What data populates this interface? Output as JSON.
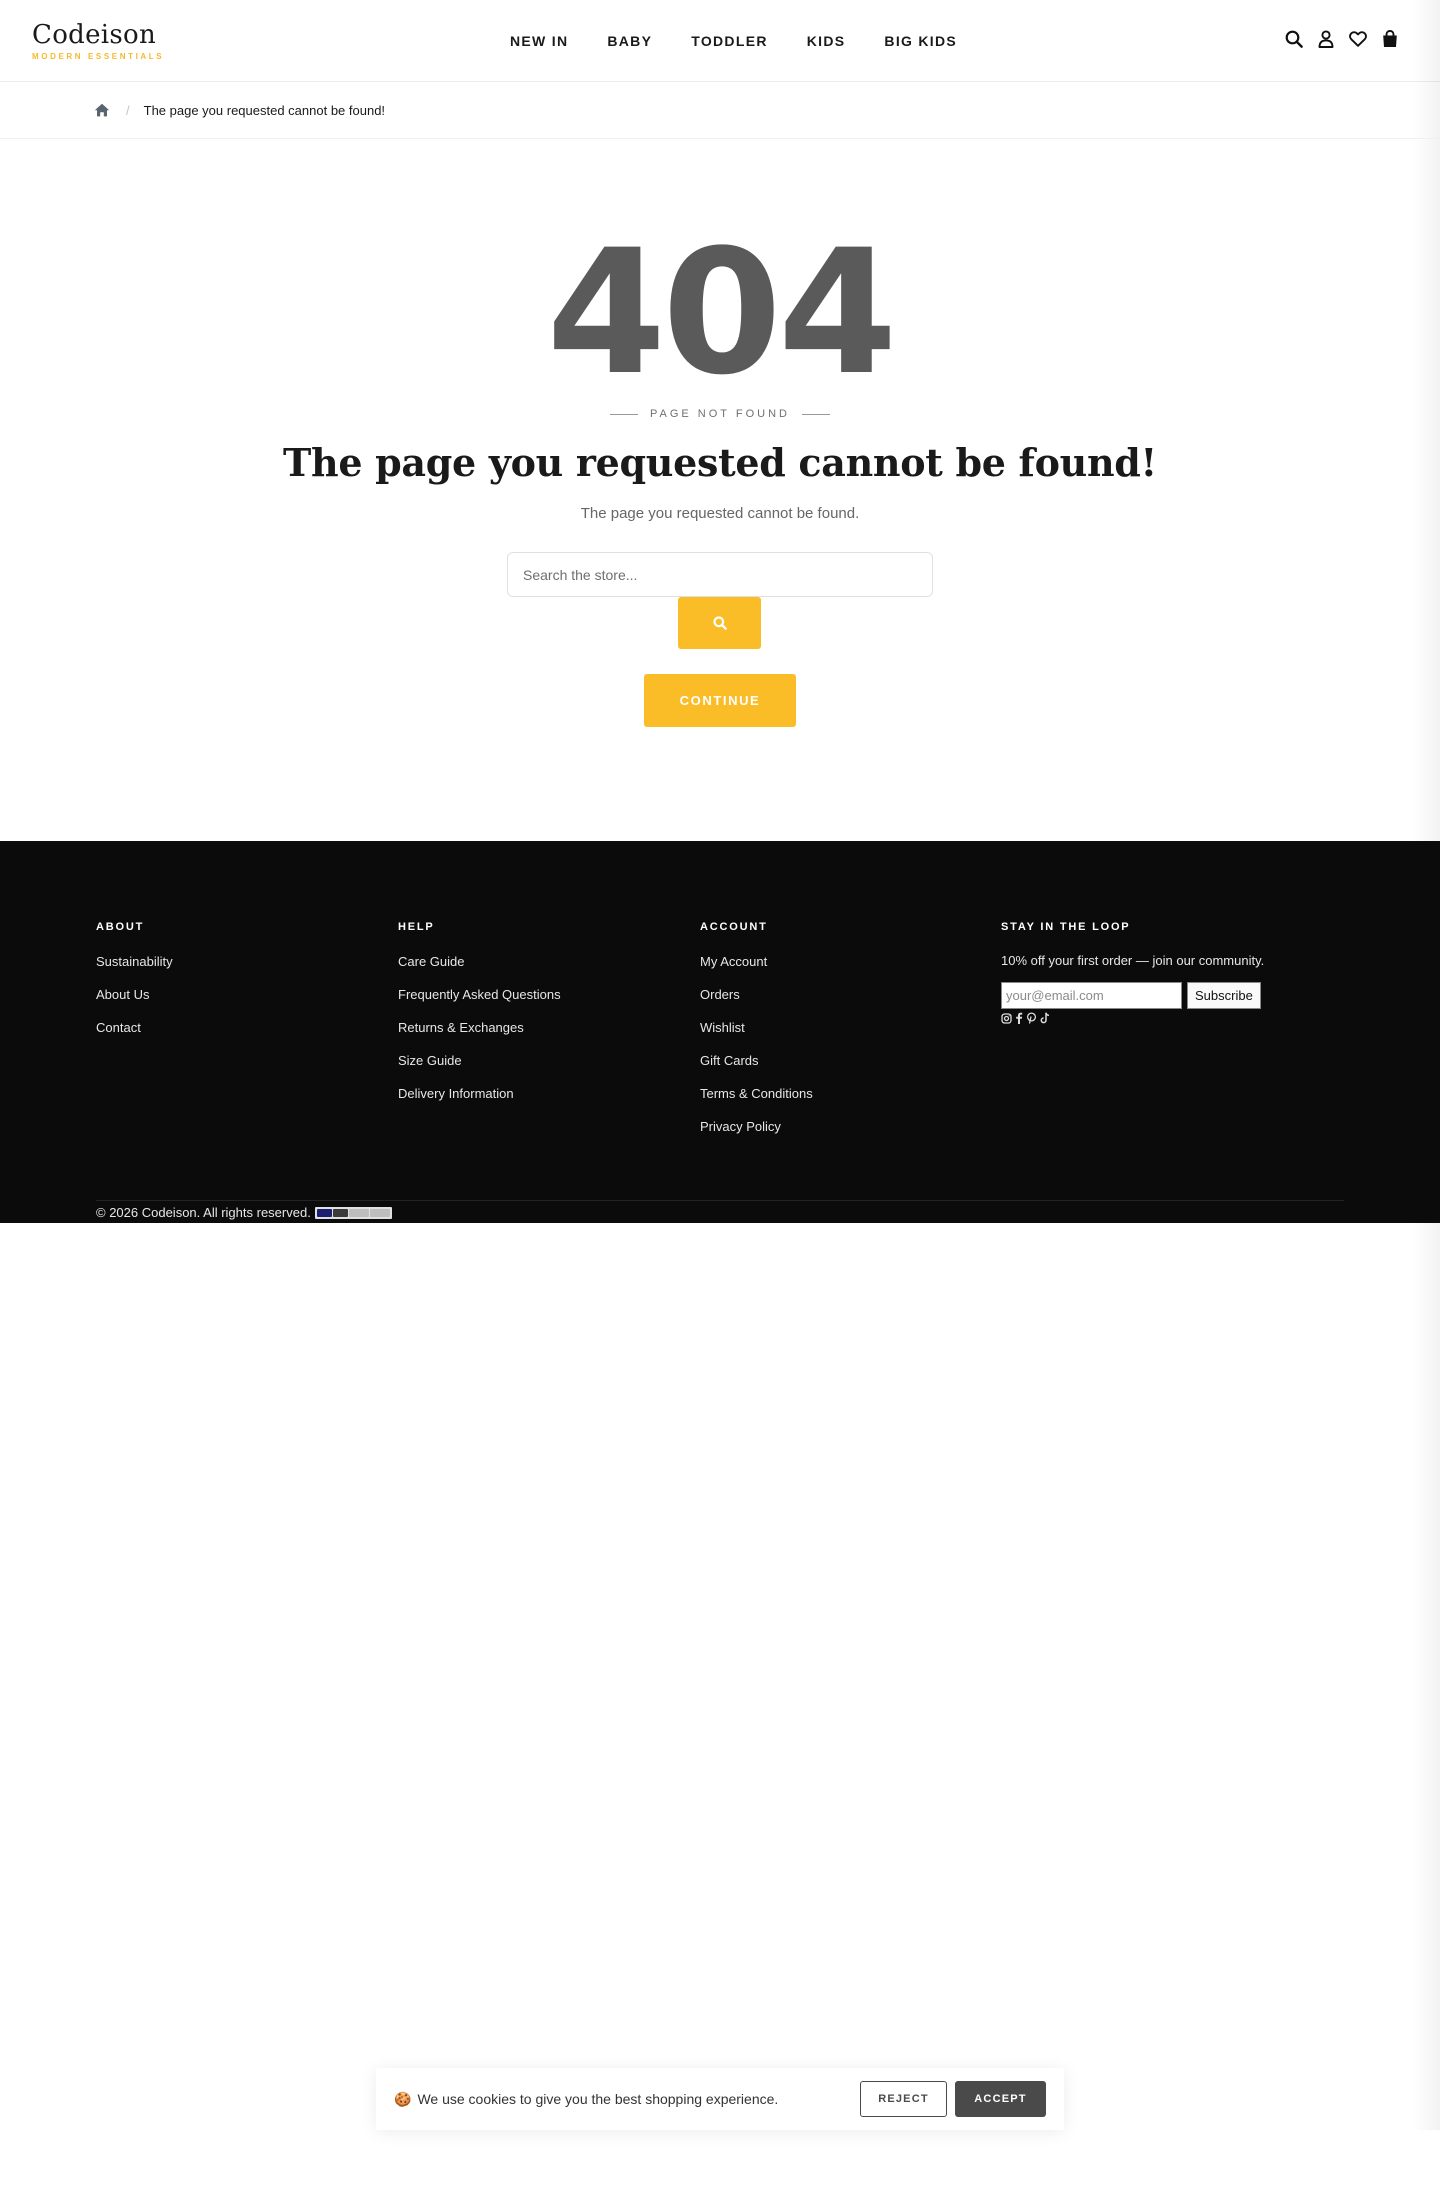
{
  "header": {
    "logo_name": "Codeison",
    "logo_tagline": "MODERN ESSENTIALS",
    "nav": [
      "NEW IN",
      "BABY",
      "TODDLER",
      "KIDS",
      "BIG KIDS"
    ],
    "icons": [
      "search-icon",
      "account-icon",
      "wishlist-icon",
      "cart-icon"
    ]
  },
  "breadcrumb": {
    "home_icon": "home-icon",
    "separator": "/",
    "current": "The page you requested cannot be found!"
  },
  "error": {
    "code": "404",
    "label": "PAGE NOT FOUND",
    "title": "The page you requested cannot be found!",
    "message": "The page you requested cannot be found.",
    "search_placeholder": "Search the store...",
    "search_icon": "search-icon",
    "continue_label": "CONTINUE"
  },
  "footer": {
    "columns": [
      {
        "title": "ABOUT",
        "links": [
          "Sustainability",
          "About Us",
          "Contact"
        ]
      },
      {
        "title": "HELP",
        "links": [
          "Care Guide",
          "Frequently Asked Questions",
          "Returns & Exchanges",
          "Size Guide",
          "Delivery Information"
        ]
      },
      {
        "title": "ACCOUNT",
        "links": [
          "My Account",
          "Orders",
          "Wishlist",
          "Gift Cards",
          "Terms & Conditions",
          "Privacy Policy"
        ]
      }
    ],
    "newsletter": {
      "title": "STAY IN THE LOOP",
      "promo": "10% off your first order — join our community.",
      "email_placeholder": "your@email.com",
      "subscribe_label": "Subscribe",
      "socials": [
        "instagram-icon",
        "facebook-icon",
        "pinterest-icon",
        "tiktok-icon"
      ]
    },
    "copyright": "© 2026 Codeison. All rights reserved.",
    "payment_icons": [
      "visa-icon",
      "mastercard-icon",
      "applepay-icon",
      "googlepay-icon"
    ]
  },
  "cookie": {
    "emoji": "🍪",
    "text": "We use cookies to give you the best shopping experience.",
    "reject_label": "REJECT",
    "accept_label": "ACCEPT"
  },
  "colors": {
    "accent": "#fbbd27",
    "footer_bg": "#0b0b0b",
    "code_grey": "#5a5a5a",
    "accept_bg": "#4a4a4a"
  }
}
